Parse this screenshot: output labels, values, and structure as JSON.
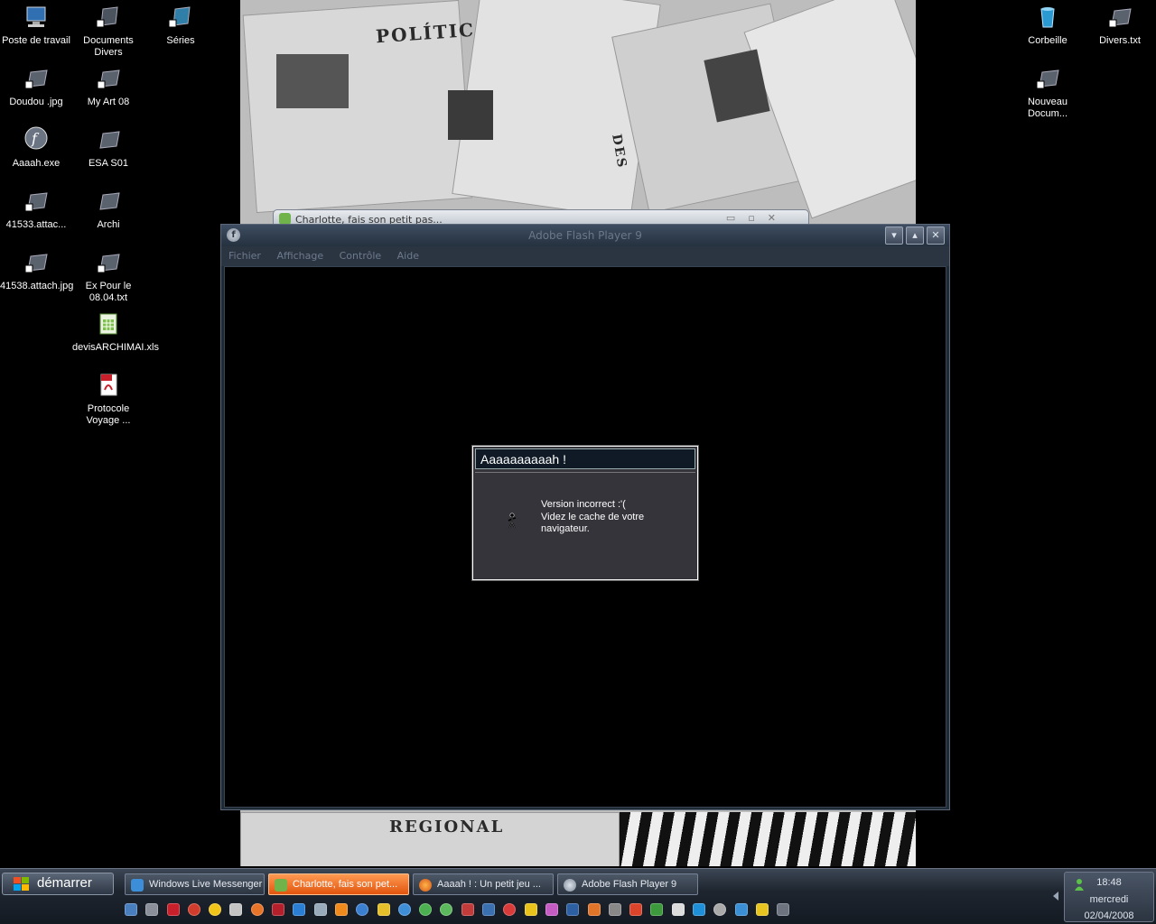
{
  "desktop": {
    "icons": [
      {
        "label": "Poste de travail",
        "icon": "computer-icon"
      },
      {
        "label": "Documents Divers",
        "icon": "folder-shortcut-icon"
      },
      {
        "label": "Séries",
        "icon": "folder-shortcut-icon"
      },
      {
        "label": "Doudou .jpg",
        "icon": "image-shortcut-icon"
      },
      {
        "label": "My Art 08",
        "icon": "folder-shortcut-icon"
      },
      {
        "label": "Aaaah.exe",
        "icon": "flash-exe-icon"
      },
      {
        "label": "ESA S01",
        "icon": "folder-icon"
      },
      {
        "label": "41533.attac...",
        "icon": "image-icon"
      },
      {
        "label": "Archi",
        "icon": "folder-icon"
      },
      {
        "label": "41538.attach.jpg",
        "icon": "image-icon"
      },
      {
        "label": "Ex Pour le 08.04.txt",
        "icon": "text-shortcut-icon"
      },
      {
        "label": "devisARCHIMAI.xls",
        "icon": "excel-icon"
      },
      {
        "label": "Protocole Voyage ...",
        "icon": "pdf-icon"
      },
      {
        "label": "Corbeille",
        "icon": "recycle-bin-icon"
      },
      {
        "label": "Divers.txt",
        "icon": "text-shortcut-icon"
      },
      {
        "label": "Nouveau Docum...",
        "icon": "document-shortcut-icon"
      }
    ],
    "wallpaper_headlines": [
      "POLÍTICA",
      "REGIONAL",
      "DES"
    ]
  },
  "background_window": {
    "title": "Charlotte, fais son petit pas..."
  },
  "flash_window": {
    "title": "Adobe Flash Player 9",
    "menu": [
      "Fichier",
      "Affichage",
      "Contrôle",
      "Aide"
    ],
    "dialog": {
      "title": "Aaaaaaaaaah !",
      "message_line1": "Version incorrect :'(",
      "message_line2": "Videz le cache de votre",
      "message_line3": "navigateur."
    }
  },
  "taskbar": {
    "start_label": "démarrer",
    "buttons": [
      {
        "label": "Windows Live Messenger",
        "icon": "messenger-icon",
        "active": false
      },
      {
        "label": "Charlotte, fais son pet...",
        "icon": "messenger-chat-icon",
        "active": true
      },
      {
        "label": "Aaaah ! : Un petit jeu ...",
        "icon": "firefox-icon",
        "active": false
      },
      {
        "label": "Adobe Flash Player 9",
        "icon": "flash-icon",
        "active": false
      }
    ],
    "clock": {
      "time": "18:48",
      "day": "mercredi",
      "date": "02/04/2008"
    }
  },
  "colors": {
    "active_taskbar": "#ef6a22",
    "flash_window_frame": "#1f2a37",
    "dialog_body": "#34343a"
  }
}
